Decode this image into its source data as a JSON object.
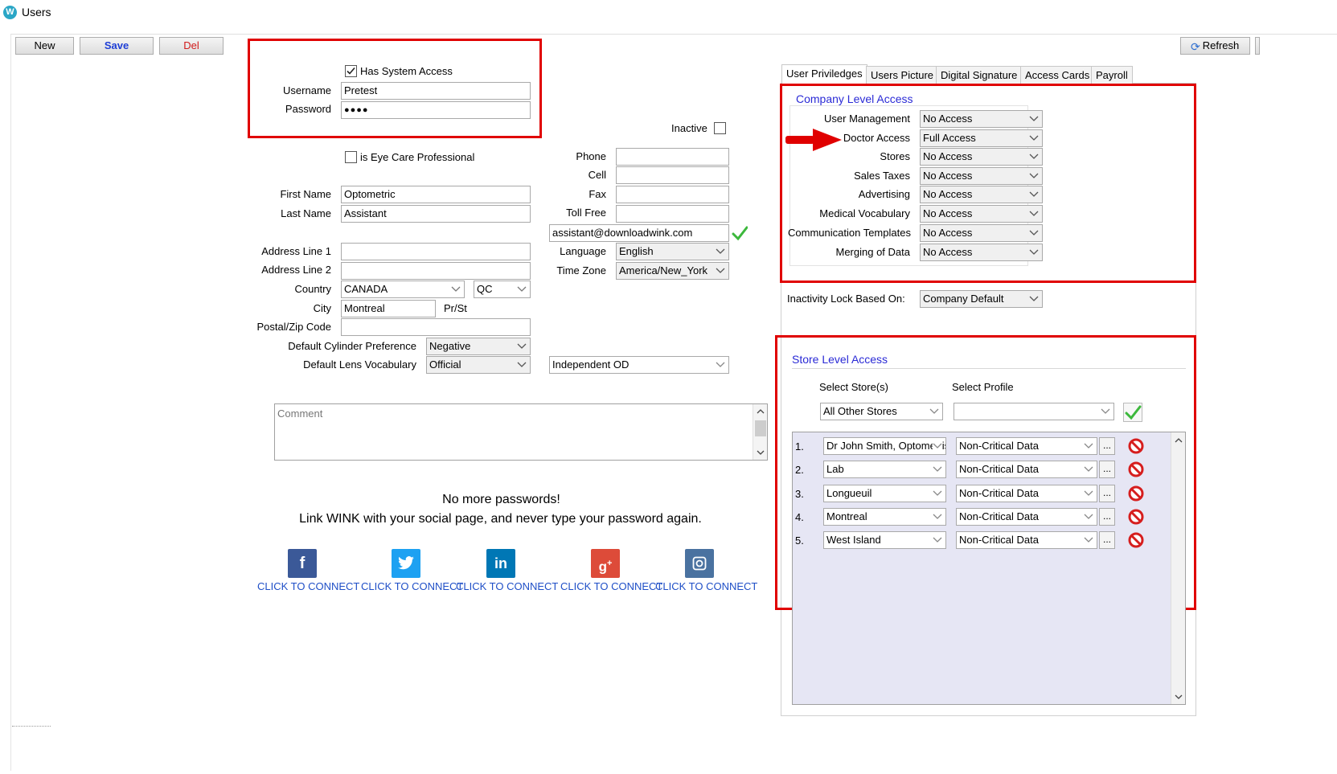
{
  "window": {
    "title": "Users",
    "app_icon": "W"
  },
  "toolbar": {
    "new": "New",
    "save": "Save",
    "del": "Del",
    "refresh": "Refresh"
  },
  "access": {
    "has_system_access": "Has System Access",
    "username_label": "Username",
    "username": "Pretest",
    "password_label": "Password",
    "password": "●●●●"
  },
  "inactive_label": "Inactive",
  "eye_care_label": "is Eye Care Professional",
  "person": {
    "first_name_label": "First Name",
    "first_name": "Optometric",
    "last_name_label": "Last Name",
    "last_name": "Assistant",
    "address1_label": "Address Line 1",
    "address1": "",
    "address2_label": "Address Line 2",
    "address2": "",
    "country_label": "Country",
    "country": "CANADA",
    "province": "QC",
    "city_label": "City",
    "city": "Montreal",
    "prst_label": "Pr/St",
    "postal_label": "Postal/Zip Code",
    "postal": "",
    "cylinder_label": "Default Cylinder Preference",
    "cylinder": "Negative",
    "lens_label": "Default Lens Vocabulary",
    "lens": "Official",
    "od_type": "Independent OD"
  },
  "contact": {
    "phone_label": "Phone",
    "cell_label": "Cell",
    "fax_label": "Fax",
    "tollfree_label": "Toll Free",
    "email": "assistant@downloadwink.com",
    "language_label": "Language",
    "language": "English",
    "timezone_label": "Time Zone",
    "timezone": "America/New_York"
  },
  "comment_placeholder": "Comment",
  "social": {
    "line1": "No more passwords!",
    "line2": "Link WINK with your social page, and never type your password again.",
    "connect": "CLICK TO CONNECT",
    "icons": [
      "facebook-icon",
      "twitter-icon",
      "linkedin-icon",
      "google-plus-icon",
      "instagram-icon"
    ],
    "colors": [
      "#3b5998",
      "#1da1f2",
      "#0077b5",
      "#dd4b39",
      "#4a72a0"
    ]
  },
  "tabs": [
    "User Priviledges",
    "Users Picture",
    "Digital Signature",
    "Access Cards",
    "Payroll"
  ],
  "company_access": {
    "title": "Company Level Access",
    "rows": [
      {
        "label": "User Management",
        "value": "No Access"
      },
      {
        "label": "Doctor Access",
        "value": "Full Access"
      },
      {
        "label": "Stores",
        "value": "No Access"
      },
      {
        "label": "Sales Taxes",
        "value": "No Access"
      },
      {
        "label": "Advertising",
        "value": "No Access"
      },
      {
        "label": "Medical Vocabulary",
        "value": "No Access"
      },
      {
        "label": "Communication Templates",
        "value": "No Access"
      },
      {
        "label": "Merging of Data",
        "value": "No Access"
      }
    ]
  },
  "inactivity": {
    "label": "Inactivity Lock Based On:",
    "value": "Company Default"
  },
  "store_access": {
    "title": "Store Level Access",
    "select_stores_label": "Select Store(s)",
    "select_profile_label": "Select Profile",
    "stores_value": "All Other Stores",
    "profile_value": "",
    "rows": [
      {
        "num": "1.",
        "store": "Dr John Smith, Optometrist",
        "profile": "Non-Critical Data"
      },
      {
        "num": "2.",
        "store": "Lab",
        "profile": "Non-Critical Data"
      },
      {
        "num": "3.",
        "store": "Longueuil",
        "profile": "Non-Critical Data"
      },
      {
        "num": "4.",
        "store": "Montreal",
        "profile": "Non-Critical Data"
      },
      {
        "num": "5.",
        "store": "West Island",
        "profile": "Non-Critical Data"
      }
    ],
    "dots": "..."
  },
  "colors": {
    "highlight": "#e00000",
    "accent_blue": "#2a2ad6",
    "link_blue": "#1f4fc7",
    "check_green": "#3cb83c"
  }
}
